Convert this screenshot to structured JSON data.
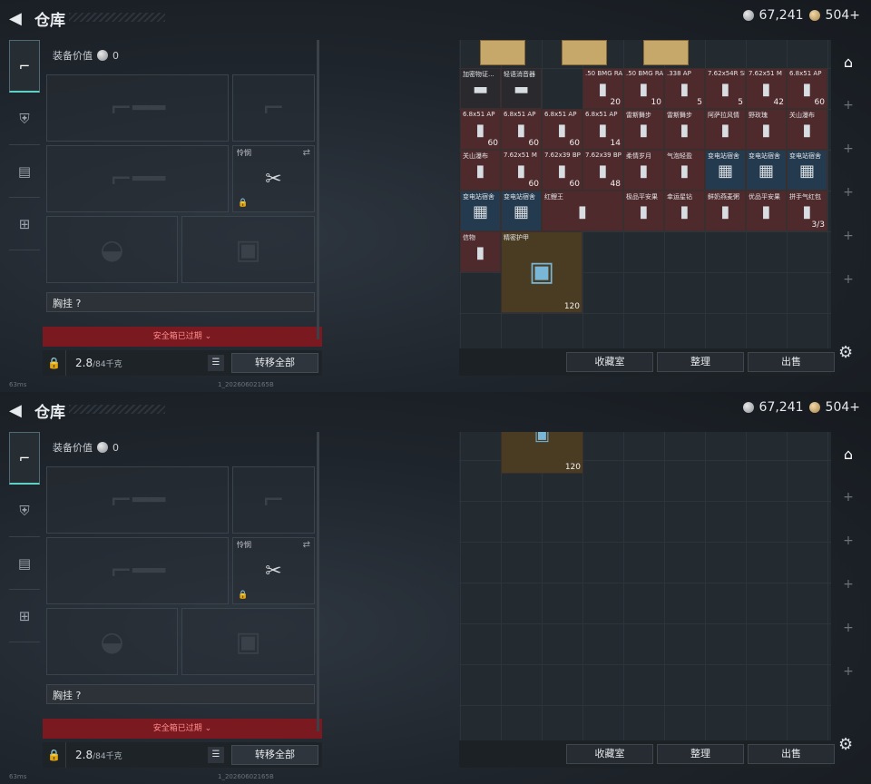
{
  "header": {
    "title": "仓库",
    "currency_silver": "67,241",
    "currency_gold": "504+"
  },
  "gear": {
    "value_label": "装备价值",
    "value": "0",
    "knife_label": "怜悯",
    "chest_label": "胸挂 ?",
    "expired_label": "安全箱已过期",
    "weight_value": "2.8",
    "weight_unit": "/84千克",
    "transfer_all": "转移全部"
  },
  "stash": {
    "items": [
      {
        "name": "加密物证...",
        "count": "",
        "color": "dark"
      },
      {
        "name": "轻语消音器",
        "count": "",
        "color": "dark"
      },
      {
        "name": ".50 BMG RAP",
        "count": "20",
        "color": "red"
      },
      {
        "name": ".50 BMG RA",
        "count": "10",
        "color": "red"
      },
      {
        "name": ".338 AP",
        "count": "5",
        "color": "red"
      },
      {
        "name": "7.62x54R SNB",
        "count": "5",
        "color": "red"
      },
      {
        "name": "7.62x51 M",
        "count": "42",
        "color": "red"
      },
      {
        "name": "6.8x51 AP",
        "count": "60",
        "color": "red"
      },
      {
        "name": "6.8x51 AP",
        "count": "60",
        "color": "red"
      },
      {
        "name": "6.8x51 AP",
        "count": "60",
        "color": "red"
      },
      {
        "name": "6.8x51 AP",
        "count": "60",
        "color": "red"
      },
      {
        "name": "6.8x51 AP",
        "count": "14",
        "color": "red"
      },
      {
        "name": "雷斯舞步",
        "count": "",
        "color": "red"
      },
      {
        "name": "雷斯舞步",
        "count": "",
        "color": "red"
      },
      {
        "name": "阿萨拉风情",
        "count": "",
        "color": "red"
      },
      {
        "name": "野玫瑰",
        "count": "",
        "color": "red"
      },
      {
        "name": "关山瀑布",
        "count": "",
        "color": "red"
      },
      {
        "name": "关山瀑布",
        "count": "",
        "color": "red"
      },
      {
        "name": "7.62x51 M",
        "count": "60",
        "color": "red"
      },
      {
        "name": "7.62x39 BP",
        "count": "60",
        "color": "red"
      },
      {
        "name": "7.62x39 BP",
        "count": "48",
        "color": "red"
      },
      {
        "name": "柔情岁月",
        "count": "",
        "color": "red"
      },
      {
        "name": "气泡轻盈",
        "count": "",
        "color": "red"
      },
      {
        "name": "变电站宿舍",
        "count": "",
        "color": "blue"
      },
      {
        "name": "变电站宿舍",
        "count": "",
        "color": "blue"
      },
      {
        "name": "变电站宿舍",
        "count": "",
        "color": "blue"
      },
      {
        "name": "变电站宿舍",
        "count": "",
        "color": "blue"
      },
      {
        "name": "变电站宿舍",
        "count": "",
        "color": "blue"
      },
      {
        "name": "红鲤王",
        "count": "",
        "color": "red"
      },
      {
        "name": "极品平安果",
        "count": "",
        "color": "red"
      },
      {
        "name": "幸运星钻",
        "count": "",
        "color": "red"
      },
      {
        "name": "鲜奶燕麦粥",
        "count": "",
        "color": "red"
      },
      {
        "name": "优品平安果",
        "count": "",
        "color": "red"
      },
      {
        "name": "拼手气红包",
        "count": "3/3",
        "color": "red"
      },
      {
        "name": "信物",
        "count": "",
        "color": "red"
      },
      {
        "name": "精密护甲",
        "count": "120",
        "color": "gold"
      }
    ],
    "buttons": {
      "collection": "收藏室",
      "organize": "整理",
      "sell": "出售"
    }
  },
  "status": {
    "ping": "63ms",
    "build": "1_20260602165B"
  },
  "colors": {
    "accent": "#5fd0c6",
    "expired_bg": "#7a1a20",
    "rarity_red": "#4e2a2c",
    "rarity_blue": "#243a4e"
  }
}
